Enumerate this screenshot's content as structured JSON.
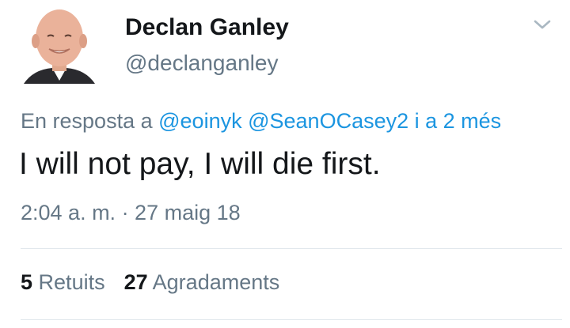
{
  "tweet": {
    "author_name": "Declan Ganley",
    "author_handle": "@declanganley",
    "reply_prefix": "En resposta a",
    "reply_mention_1": "@eoinyk",
    "reply_mention_2": "@SeanOCasey2",
    "reply_suffix": "i a 2 més",
    "text": "I will not pay, I will die first.",
    "timestamp": "2:04 a. m. · 27 maig 18",
    "retweets_count": "5",
    "retweets_label": "Retuits",
    "likes_count": "27",
    "likes_label": "Agradaments"
  },
  "icons": {
    "menu": "chevron-down-icon",
    "avatar": "avatar"
  },
  "colors": {
    "link": "#1b95e0",
    "secondary_text": "#657786",
    "primary_text": "#14171a",
    "divider": "#e1e8ed"
  }
}
